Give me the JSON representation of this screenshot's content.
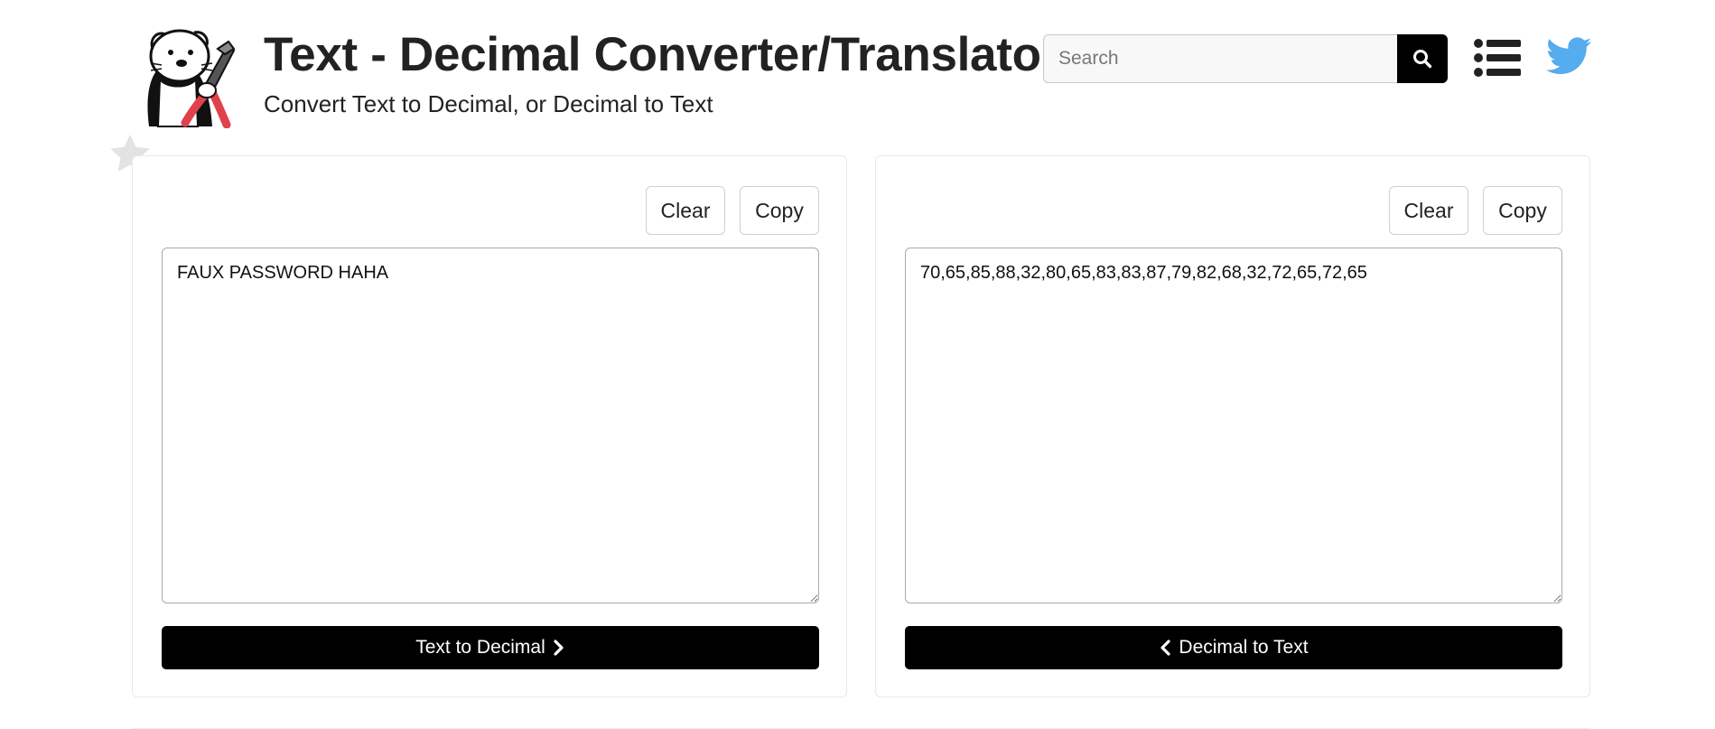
{
  "header": {
    "title": "Text - Decimal Converter/Translator",
    "subtitle": "Convert Text to Decimal, or Decimal to Text",
    "logo_icon": "otter-holding-pliers-logo"
  },
  "search": {
    "placeholder": "Search",
    "button_icon": "search-icon"
  },
  "nav": {
    "menu_icon": "list-icon",
    "twitter_icon": "twitter-bird-icon",
    "twitter_color": "#55acee"
  },
  "favorite": {
    "icon": "star-icon",
    "color": "#e3e3e3"
  },
  "left_panel": {
    "clear_label": "Clear",
    "copy_label": "Copy",
    "text_value": "FAUX PASSWORD HAHA",
    "convert_label": "Text to Decimal",
    "convert_icon": "chevron-right-icon"
  },
  "right_panel": {
    "clear_label": "Clear",
    "copy_label": "Copy",
    "text_value": "70,65,85,88,32,80,65,83,83,87,79,82,68,32,72,65,72,65",
    "convert_label": "Decimal to Text",
    "convert_icon": "chevron-left-icon"
  },
  "colors": {
    "button_dark": "#000000",
    "logo_accent": "#e0414b",
    "border": "#cfcfcf"
  }
}
